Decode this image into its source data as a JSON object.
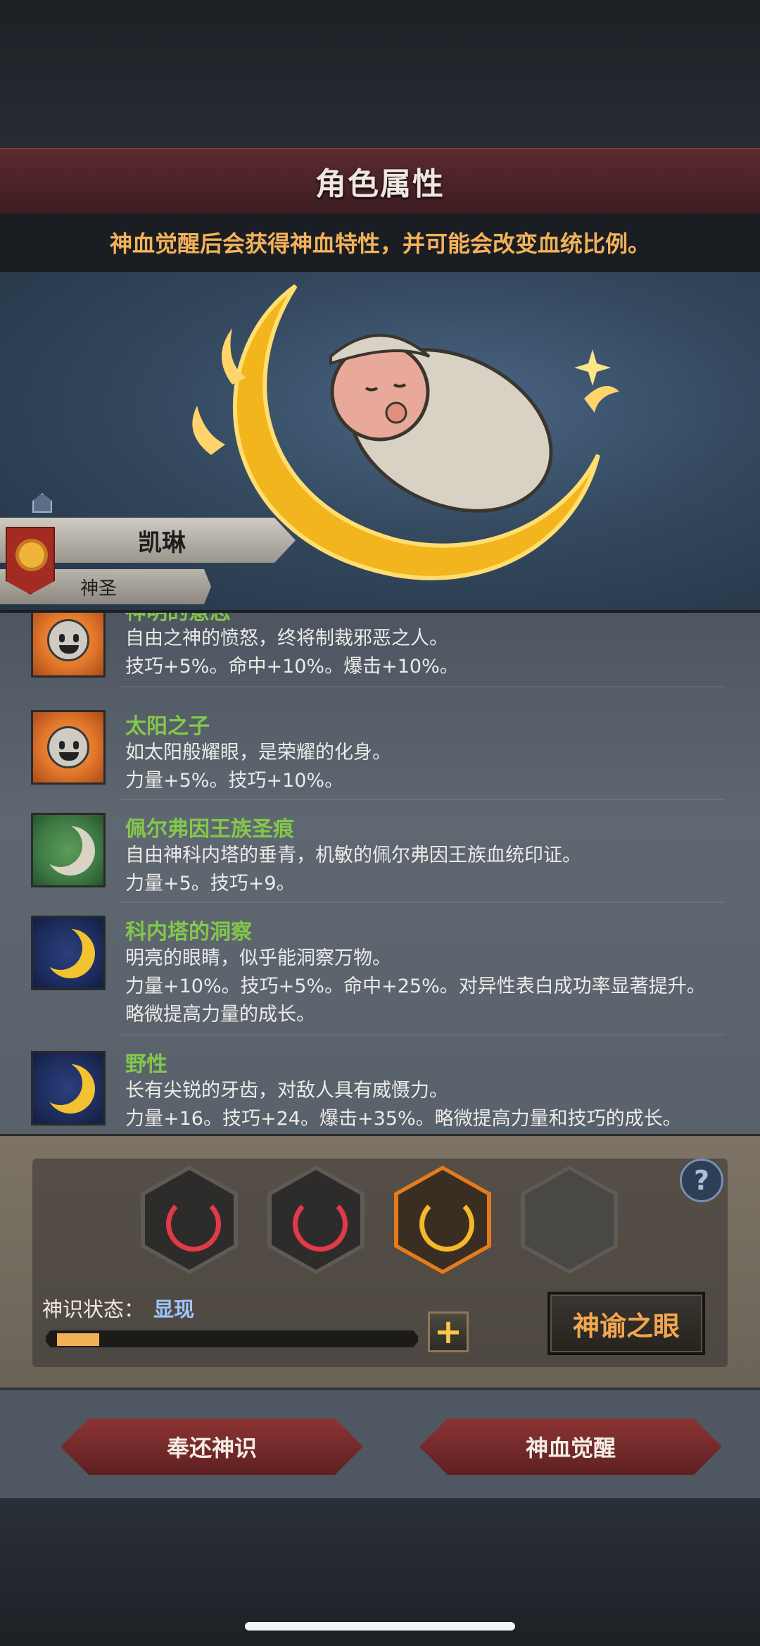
{
  "header": {
    "title": "角色属性",
    "notice": "神血觉醒后会获得神血特性，并可能会改变血统比例。"
  },
  "character": {
    "name": "凯琳",
    "rank": "神圣"
  },
  "traits": [
    {
      "name": "神明的意志",
      "desc": "自由之神的愤怒，终将制裁邪恶之人。",
      "effects": "技巧+5%。命中+10%。爆击+10%。",
      "icon": "sun-face-icon"
    },
    {
      "name": "太阳之子",
      "desc": "如太阳般耀眼，是荣耀的化身。",
      "effects": "力量+5%。技巧+10%。",
      "icon": "sun-face-icon"
    },
    {
      "name": "佩尔弗因王族圣痕",
      "desc": "自由神科内塔的垂青，机敏的佩尔弗因王族血统印证。",
      "effects": "力量+5。技巧+9。",
      "icon": "white-moon-icon"
    },
    {
      "name": "科内塔的洞察",
      "desc": "明亮的眼睛，似乎能洞察万物。",
      "effects": "力量+10%。技巧+5%。命中+25%。对异性表白成功率显著提升。",
      "effects2": "略微提高力量的成长。",
      "icon": "gold-moon-icon"
    },
    {
      "name": "野性",
      "desc": "长有尖锐的牙齿，对敌人具有威慑力。",
      "effects": "力量+16。技巧+24。爆击+35%。略微提高力量和技巧的成长。",
      "icon": "gold-moon-icon"
    }
  ],
  "awakening": {
    "state_label": "神识状态：",
    "state_value": "显现",
    "progress": 0.12,
    "slots": [
      "red",
      "red",
      "gold",
      "empty"
    ],
    "help": "?",
    "plus": "+",
    "oracle_button": "神谕之眼"
  },
  "actions": {
    "return_button": "奉还神识",
    "awaken_button": "神血觉醒"
  },
  "colors": {
    "trait_name": "#83c84a",
    "notice_text": "#f3b25a",
    "state_value": "#9fc4ff",
    "progress_fill": "#f2b058",
    "oracle_text": "#f2a64e"
  }
}
